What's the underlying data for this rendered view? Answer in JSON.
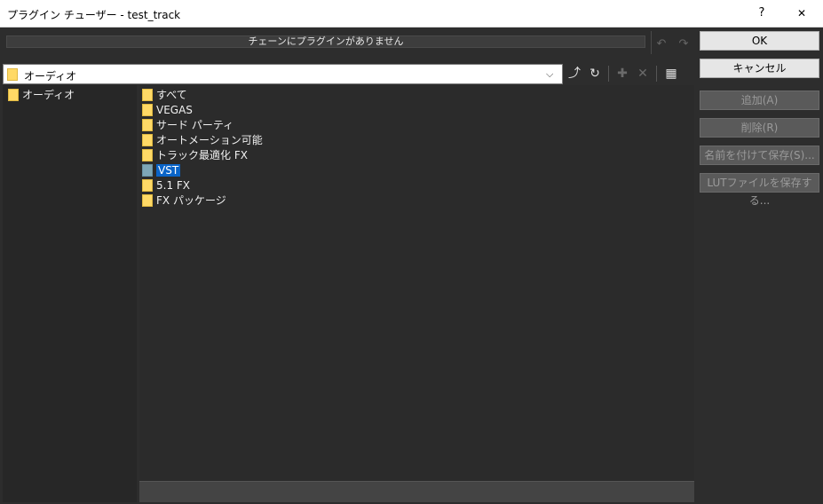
{
  "window": {
    "title": "プラグイン チューザー - test_track",
    "help": "?",
    "close": "✕"
  },
  "chain": {
    "message": "チェーンにプラグインがありません",
    "undo_icon": "↶",
    "redo_icon": "↷"
  },
  "path": {
    "value": "オーディオ",
    "arrow": "⌵"
  },
  "toolbar": {
    "up_folder_icon": "⤴",
    "refresh_icon": "↻",
    "pin_icon": "✚",
    "delete_icon": "✕",
    "view_icon": "▦"
  },
  "tree": {
    "items": [
      {
        "label": "オーディオ"
      }
    ]
  },
  "list": {
    "items": [
      {
        "label": "すべて"
      },
      {
        "label": "VEGAS"
      },
      {
        "label": "サード パーティ"
      },
      {
        "label": "オートメーション可能"
      },
      {
        "label": "トラック最適化 FX"
      },
      {
        "label": "VST",
        "selected": true
      },
      {
        "label": "5.1 FX"
      },
      {
        "label": "FX パッケージ"
      }
    ]
  },
  "buttons": {
    "ok": "OK",
    "cancel": "キャンセル",
    "add": "追加(A)",
    "delete": "削除(R)",
    "save_as": "名前を付けて保存(S)...",
    "save_lut": "LUTファイルを保存する..."
  }
}
